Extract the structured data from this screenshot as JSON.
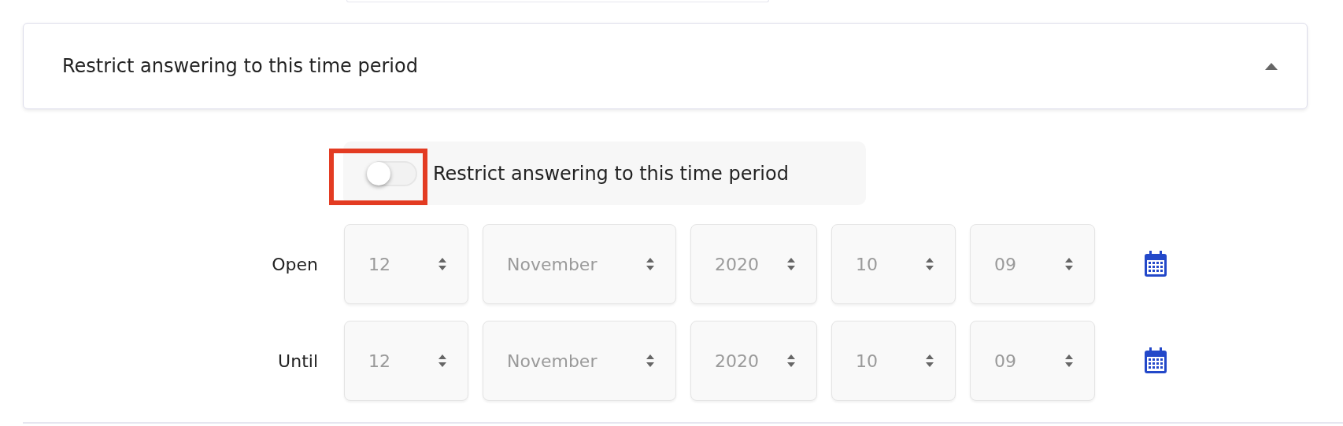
{
  "section": {
    "title": "Restrict answering to this time period",
    "expanded": true
  },
  "toggle": {
    "label": "Restrict answering to this time period",
    "on": false,
    "highlighted": true
  },
  "date_rows": [
    {
      "label": "Open",
      "fields": [
        "12",
        "November",
        "2020",
        "10",
        "09"
      ]
    },
    {
      "label": "Until",
      "fields": [
        "12",
        "November",
        "2020",
        "10",
        "09"
      ]
    }
  ]
}
